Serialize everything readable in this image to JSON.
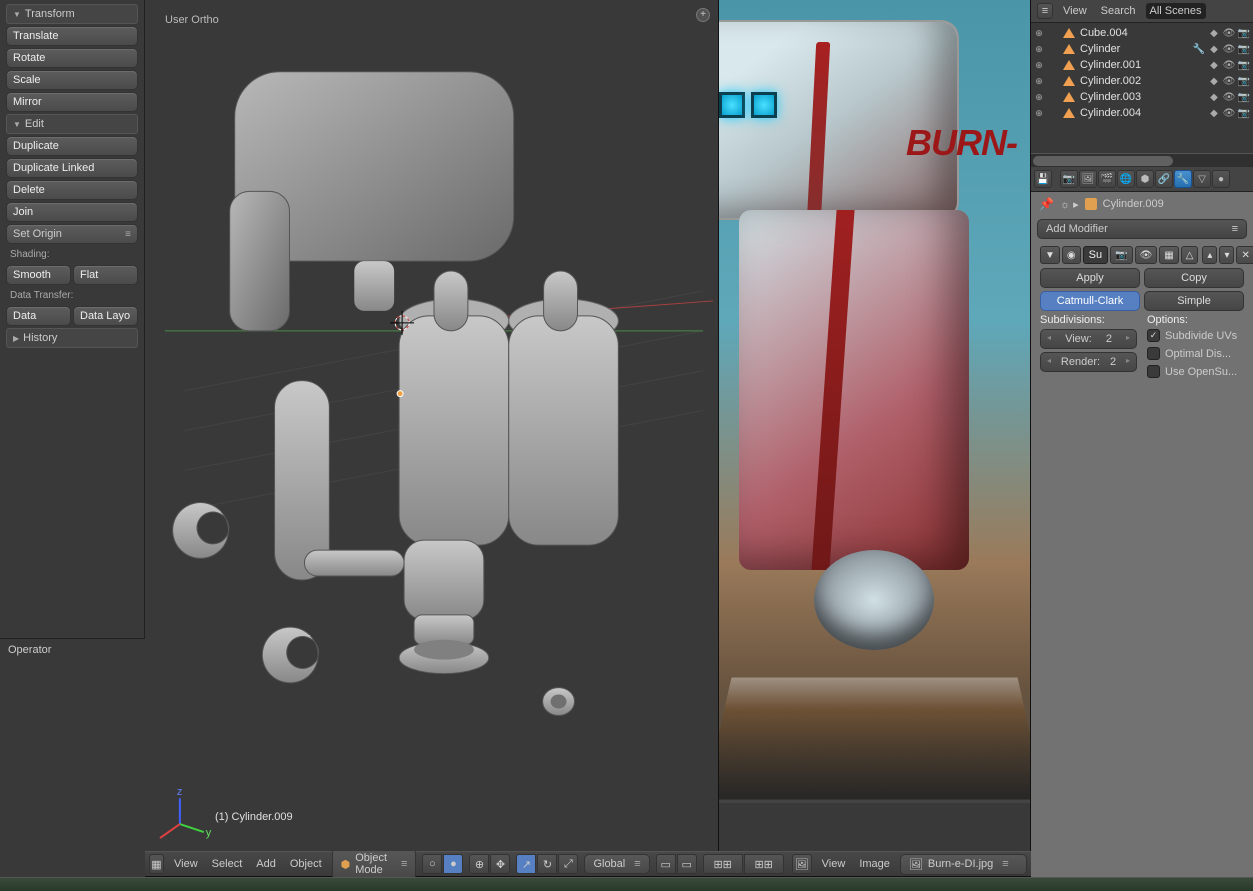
{
  "tools": {
    "transform_header": "Transform",
    "translate": "Translate",
    "rotate": "Rotate",
    "scale": "Scale",
    "mirror": "Mirror",
    "edit_header": "Edit",
    "duplicate": "Duplicate",
    "duplicate_linked": "Duplicate Linked",
    "delete": "Delete",
    "join": "Join",
    "set_origin": "Set Origin",
    "shading_label": "Shading:",
    "smooth": "Smooth",
    "flat": "Flat",
    "data_transfer_label": "Data Transfer:",
    "data": "Data",
    "data_layout": "Data Layo",
    "history_header": "History"
  },
  "operator_panel": "Operator",
  "viewport": {
    "view_label": "User Ortho",
    "object_label": "(1) Cylinder.009"
  },
  "viewport_header": {
    "menu_view": "View",
    "menu_select": "Select",
    "menu_add": "Add",
    "menu_object": "Object",
    "mode": "Object Mode",
    "orientation": "Global"
  },
  "image_header": {
    "menu_view": "View",
    "menu_image": "Image",
    "file": "Burn-e-DI.jpg"
  },
  "outliner_header": {
    "view": "View",
    "search": "Search",
    "filter": "All Scenes"
  },
  "outliner": [
    {
      "name": "Cube.004",
      "icons": [
        "◆",
        "👁",
        "📷"
      ]
    },
    {
      "name": "Cylinder",
      "icons": [
        "🔧",
        "◆",
        "👁",
        "📷"
      ]
    },
    {
      "name": "Cylinder.001",
      "icons": [
        "◆",
        "👁",
        "📷"
      ]
    },
    {
      "name": "Cylinder.002",
      "icons": [
        "◆",
        "👁",
        "📷"
      ]
    },
    {
      "name": "Cylinder.003",
      "icons": [
        "◆",
        "👁",
        "📷"
      ]
    },
    {
      "name": "Cylinder.004",
      "icons": [
        "◆",
        "👁",
        "📷"
      ]
    }
  ],
  "properties": {
    "context_object": "Cylinder.009",
    "add_modifier": "Add Modifier",
    "subsurf_name": "Su",
    "apply": "Apply",
    "copy": "Copy",
    "catmull": "Catmull-Clark",
    "simple": "Simple",
    "subdivisions_label": "Subdivisions:",
    "options_label": "Options:",
    "view_label": "View:",
    "view_val": "2",
    "render_label": "Render:",
    "render_val": "2",
    "subdivide_uvs": "Subdivide UVs",
    "optimal": "Optimal Dis...",
    "opensub": "Use OpenSu..."
  },
  "reference": {
    "brand": "BURN-"
  }
}
